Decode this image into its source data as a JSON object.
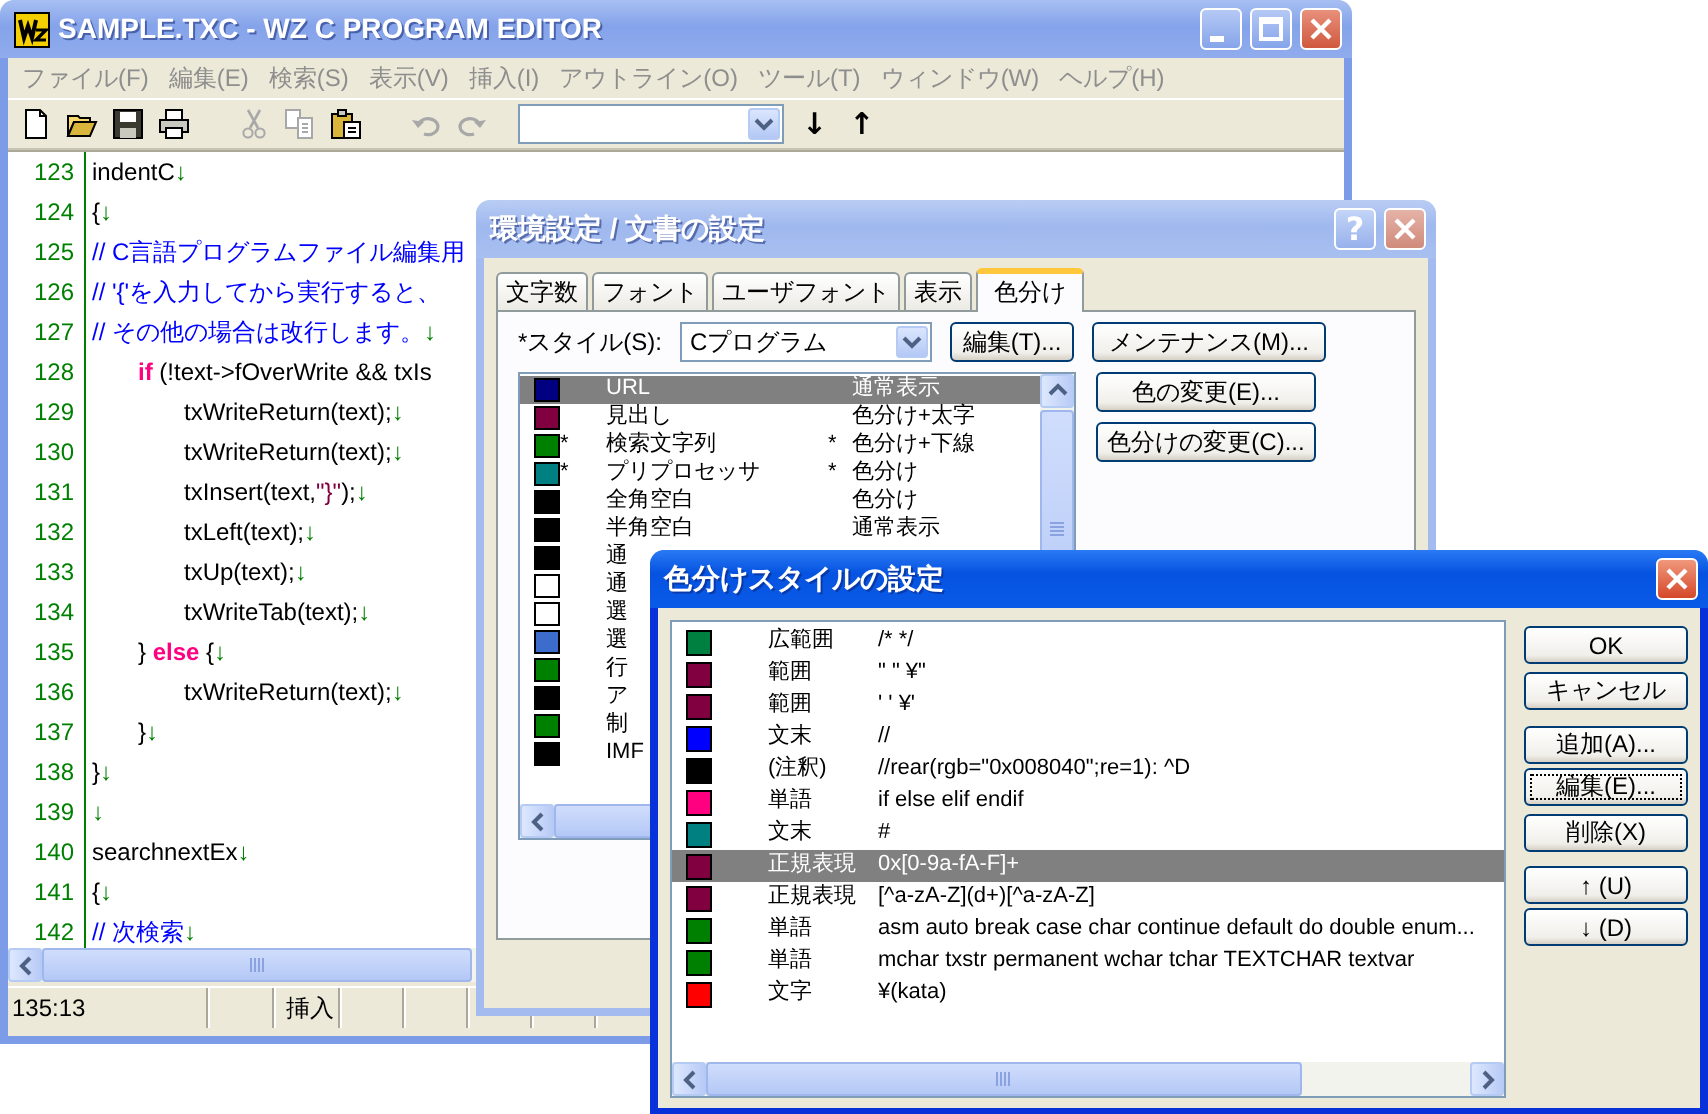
{
  "main_window": {
    "title": "SAMPLE.TXC - WZ C PROGRAM EDITOR",
    "menu": [
      "ファイル(F)",
      "編集(E)",
      "検索(S)",
      "表示(V)",
      "挿入(I)",
      "アウトライン(O)",
      "ツール(T)",
      "ウィンドウ(W)",
      "ヘルプ(H)"
    ],
    "toolbar": [
      {
        "kind": "new",
        "disabled": false
      },
      {
        "kind": "open",
        "disabled": false
      },
      {
        "kind": "save",
        "disabled": false
      },
      {
        "kind": "print",
        "disabled": false
      },
      {
        "kind": "cut",
        "disabled": true
      },
      {
        "kind": "copy",
        "disabled": true
      },
      {
        "kind": "paste",
        "disabled": false
      },
      {
        "kind": "undo",
        "disabled": true
      },
      {
        "kind": "redo",
        "disabled": true
      }
    ],
    "nav_buttons": [
      "↓",
      "↑"
    ],
    "editor": {
      "lines": [
        {
          "number": "123",
          "segments": [
            {
              "kind": "text",
              "text": "indentC"
            },
            {
              "kind": "eol",
              "text": "↓"
            }
          ]
        },
        {
          "number": "124",
          "segments": [
            {
              "kind": "text",
              "text": "{"
            },
            {
              "kind": "eol",
              "text": "↓"
            }
          ]
        },
        {
          "number": "125",
          "segments": [
            {
              "kind": "comment",
              "text": "// C言語プログラムファイル編集用"
            }
          ]
        },
        {
          "number": "126",
          "segments": [
            {
              "kind": "comment",
              "text": "// '{'を入力してから実行すると、"
            }
          ]
        },
        {
          "number": "127",
          "segments": [
            {
              "kind": "comment",
              "text": "// その他の場合は改行します。"
            },
            {
              "kind": "eol",
              "text": "↓"
            }
          ]
        },
        {
          "number": "128",
          "segments": [
            {
              "kind": "keyword",
              "text": "\tif"
            },
            {
              "kind": "text",
              "text": " (!text->fOverWrite && txIs"
            }
          ]
        },
        {
          "number": "129",
          "segments": [
            {
              "kind": "text",
              "text": "\t\ttxWriteReturn(text);"
            },
            {
              "kind": "eol",
              "text": "↓"
            }
          ]
        },
        {
          "number": "130",
          "segments": [
            {
              "kind": "text",
              "text": "\t\ttxWriteReturn(text);"
            },
            {
              "kind": "eol",
              "text": "↓"
            }
          ]
        },
        {
          "number": "131",
          "segments": [
            {
              "kind": "text",
              "text": "\t\ttxInsert(text,"
            },
            {
              "kind": "string",
              "text": "\"}\""
            },
            {
              "kind": "text",
              "text": ");"
            },
            {
              "kind": "eol",
              "text": "↓"
            }
          ]
        },
        {
          "number": "132",
          "segments": [
            {
              "kind": "text",
              "text": "\t\ttxLeft(text);"
            },
            {
              "kind": "eol",
              "text": "↓"
            }
          ]
        },
        {
          "number": "133",
          "segments": [
            {
              "kind": "text",
              "text": "\t\ttxUp(text);"
            },
            {
              "kind": "eol",
              "text": "↓"
            }
          ]
        },
        {
          "number": "134",
          "segments": [
            {
              "kind": "text",
              "text": "\t\ttxWriteTab(text);"
            },
            {
              "kind": "eol",
              "text": "↓"
            }
          ]
        },
        {
          "number": "135",
          "segments": [
            {
              "kind": "text",
              "text": "\t} "
            },
            {
              "kind": "keyword",
              "text": "else"
            },
            {
              "kind": "text",
              "text": " {"
            },
            {
              "kind": "eol",
              "text": "↓"
            }
          ]
        },
        {
          "number": "136",
          "segments": [
            {
              "kind": "text",
              "text": "\t\ttxWriteReturn(text);"
            },
            {
              "kind": "eol",
              "text": "↓"
            }
          ]
        },
        {
          "number": "137",
          "segments": [
            {
              "kind": "text",
              "text": "\t}"
            },
            {
              "kind": "eol",
              "text": "↓"
            }
          ]
        },
        {
          "number": "138",
          "segments": [
            {
              "kind": "text",
              "text": "}"
            },
            {
              "kind": "eol",
              "text": "↓"
            }
          ]
        },
        {
          "number": "139",
          "segments": [
            {
              "kind": "eol",
              "text": "↓"
            }
          ]
        },
        {
          "number": "140",
          "segments": [
            {
              "kind": "text",
              "text": "searchnextEx"
            },
            {
              "kind": "eol",
              "text": "↓"
            }
          ]
        },
        {
          "number": "141",
          "segments": [
            {
              "kind": "text",
              "text": "{"
            },
            {
              "kind": "eol",
              "text": "↓"
            }
          ]
        },
        {
          "number": "142",
          "segments": [
            {
              "kind": "comment",
              "text": "// 次検索"
            },
            {
              "kind": "eol",
              "text": "↓"
            }
          ]
        }
      ]
    },
    "status_bar": {
      "position": "135:13",
      "mode": "挿入"
    }
  },
  "settings_dialog": {
    "title": "環境設定 / 文書の設定",
    "help_button": "?",
    "tabs": [
      {
        "label": "文字数",
        "selected": false
      },
      {
        "label": "フォント",
        "selected": false
      },
      {
        "label": "ユーザフォント",
        "selected": false
      },
      {
        "label": "表示",
        "selected": false
      },
      {
        "label": "色分け",
        "selected": true
      }
    ],
    "style_label": "*スタイル(S):",
    "style_combo": "Cプログラム",
    "top_buttons": [
      "編集(T)...",
      "メンテナンス(M)..."
    ],
    "side_buttons": [
      "色の変更(E)...",
      "色分けの変更(C)..."
    ],
    "items": [
      {
        "color": "#000080",
        "name": "URL",
        "style": "通常表示",
        "selected": true
      },
      {
        "color": "#800040",
        "name": "見出し",
        "style": "色分け+太字",
        "selected": false
      },
      {
        "color": "#008000",
        "mark": "*",
        "name": "検索文字列",
        "style_mark": "*",
        "style": "色分け+下線",
        "selected": false
      },
      {
        "color": "#008080",
        "mark": "*",
        "name": "プリプロセッサ",
        "style_mark": "*",
        "style": "色分け",
        "selected": false
      },
      {
        "color": "#000000",
        "name": "全角空白",
        "style": "色分け",
        "selected": false
      },
      {
        "color": "#000000",
        "name": "半角空白",
        "style": "通常表示",
        "selected": false
      },
      {
        "color": "#000000",
        "name": "通",
        "selected": false
      },
      {
        "color": "#ffffff",
        "name": "通",
        "selected": false
      },
      {
        "color": "#ffffff",
        "name": "選",
        "selected": false
      },
      {
        "color": "#3c6ccc",
        "name": "選",
        "selected": false
      },
      {
        "color": "#008000",
        "name": "行",
        "selected": false
      },
      {
        "color": "#000000",
        "name": "ア",
        "selected": false
      },
      {
        "color": "#008000",
        "name": "制",
        "selected": false
      },
      {
        "color": "#000000",
        "name": "IMF",
        "selected": false
      }
    ]
  },
  "style_dialog": {
    "title": "色分けスタイルの設定",
    "rules": [
      {
        "color": "#008040",
        "type": "広範囲",
        "pattern": "/* */",
        "selected": false
      },
      {
        "color": "#800040",
        "type": "範囲",
        "pattern": "\" \" ¥\"",
        "selected": false
      },
      {
        "color": "#800040",
        "type": "範囲",
        "pattern": "' ' ¥'",
        "selected": false
      },
      {
        "color": "#0000ff",
        "type": "文末",
        "pattern": "//",
        "selected": false
      },
      {
        "color": "#000000",
        "type": "(注釈)",
        "pattern": "//rear(rgb=\"0x008040\";re=1): ^D",
        "selected": false
      },
      {
        "color": "#ff0080",
        "type": "単語",
        "pattern": "if else elif endif",
        "selected": false
      },
      {
        "color": "#008080",
        "type": "文末",
        "pattern": "#",
        "selected": false
      },
      {
        "color": "#800040",
        "type": "正規表現",
        "pattern": "0x[0-9a-fA-F]+",
        "selected": true
      },
      {
        "color": "#800040",
        "type": "正規表現",
        "pattern": "[^a-zA-Z](d+)[^a-zA-Z]",
        "selected": false
      },
      {
        "color": "#008000",
        "type": "単語",
        "pattern": "asm auto break case char continue default do double enum...",
        "selected": false
      },
      {
        "color": "#008000",
        "type": "単語",
        "pattern": "mchar txstr permanent wchar tchar TEXTCHAR textvar",
        "selected": false
      },
      {
        "color": "#ff0000",
        "type": "文字",
        "pattern": "¥(kata)",
        "selected": false
      }
    ],
    "buttons": [
      {
        "label": "OK",
        "focused": false
      },
      {
        "label": "キャンセル",
        "focused": false
      },
      {
        "label": "追加(A)...",
        "focused": false
      },
      {
        "label": "編集(E)...",
        "focused": true
      },
      {
        "label": "削除(X)",
        "focused": false
      },
      {
        "label": "↑ (U)",
        "focused": false
      },
      {
        "label": "↓ (D)",
        "focused": false
      }
    ]
  }
}
